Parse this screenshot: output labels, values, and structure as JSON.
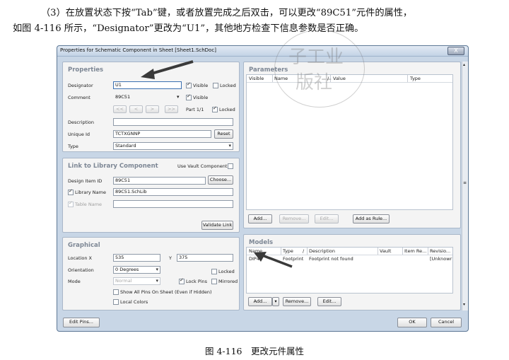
{
  "document": {
    "paragraph_line1": "（3）在放置状态下按“Tab”键，或者放置完成之后双击，可以更改“89C51”元件的属性，",
    "paragraph_line2": "如图 4-116 所示，“Designator”更改为“U1”，其他地方检查下信息参数是否正确。",
    "caption": "图 4-116　更改元件属性"
  },
  "watermark": {
    "text": "子工业",
    "text2": "版社"
  },
  "dialog": {
    "title": "Properties for Schematic Component in Sheet [Sheet1.SchDoc]",
    "close_label": "X",
    "properties": {
      "title": "Properties",
      "designator_label": "Designator",
      "designator_value": "U1",
      "visible_label": "Visible",
      "locked_label": "Locked",
      "comment_label": "Comment",
      "comment_value": "89C51",
      "comment_visible_label": "Visible",
      "nav_first": "<<",
      "nav_prev": "<",
      "nav_next": ">",
      "nav_last": ">>",
      "part_label": "Part 1/1",
      "part_locked_label": "Locked",
      "description_label": "Description",
      "description_value": "",
      "unique_id_label": "Unique Id",
      "unique_id_value": "TCTXGNNP",
      "reset_label": "Reset",
      "type_label": "Type",
      "type_value": "Standard"
    },
    "library": {
      "title": "Link to Library Component",
      "use_vault_label": "Use Vault Component",
      "design_item_label": "Design Item ID",
      "design_item_value": "89C51",
      "choose_label": "Choose...",
      "library_name_label": "Library Name",
      "library_name_value": "89C51.SchLib",
      "table_name_label": "Table Name",
      "table_name_value": "",
      "validate_label": "Validate Link"
    },
    "graphical": {
      "title": "Graphical",
      "location_label": "Location  X",
      "location_x": "535",
      "y_label": "Y",
      "location_y": "375",
      "orientation_label": "Orientation",
      "orientation_value": "0 Degrees",
      "locked_label": "Locked",
      "mode_label": "Mode",
      "mode_value": "Normal",
      "lock_pins_label": "Lock Pins",
      "mirrored_label": "Mirrored",
      "show_pins_label": "Show All Pins On Sheet (Even if Hidden)",
      "local_colors_label": "Local Colors"
    },
    "parameters": {
      "title": "Parameters",
      "columns": [
        "Visible",
        "Name",
        "/",
        "Value",
        "Type"
      ],
      "add_label": "Add...",
      "remove_label": "Remove...",
      "edit_label": "Edit...",
      "add_rule_label": "Add as Rule..."
    },
    "models": {
      "title": "Models",
      "columns": [
        "Name",
        "Type",
        "/",
        "Description",
        "Vault",
        "Item Re...",
        "Revisio..."
      ],
      "rows": [
        {
          "name": "DIP40",
          "type": "Footprint",
          "description": "Footprint not found",
          "vault": "",
          "item": "",
          "revision": "[Unknowr"
        }
      ],
      "add_label": "Add...",
      "remove_label": "Remove...",
      "edit_label": "Edit..."
    },
    "footer": {
      "edit_pins_label": "Edit Pins...",
      "ok_label": "OK",
      "cancel_label": "Cancel"
    }
  }
}
